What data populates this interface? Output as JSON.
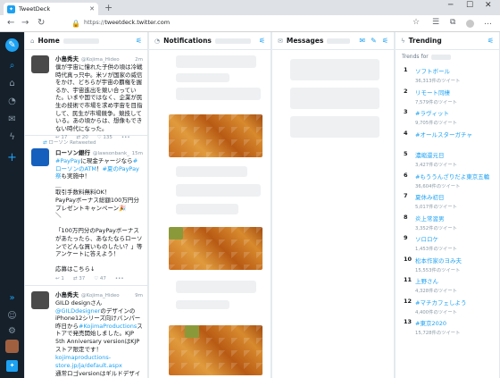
{
  "browser": {
    "tab_title": "TweetDeck",
    "tab_icon": "twitter-bird-icon",
    "url_prefix": "https://",
    "url_host": "tweetdeck.twitter.com"
  },
  "columns": {
    "home": {
      "title": "Home"
    },
    "notifications": {
      "title": "Notifications"
    },
    "messages": {
      "title": "Messages"
    },
    "trending": {
      "title": "Trending",
      "trends_for": "Trends for"
    }
  },
  "tweets": [
    {
      "name": "小島秀夫",
      "handle": "@Kojima_Hideo",
      "time": "2m",
      "body": "僕が宇宙に憧れた子供の頃は冷戦時代真っ只中。米ソが国家の威信をかけ、どちらが宇宙の覇権を握るか、宇宙進出を競い合っていた。いまや国ではなく、企業が民生の技術で市場を求め宇宙を目指して、民生が市場競争。競技している。あの頃からは、想像もできない時代になった。",
      "replies": "17",
      "retweets": "20",
      "likes": "135"
    },
    {
      "retweet_note": "ローソン Retweeted",
      "name": "ローソン銀行",
      "handle": "@lawsonbank_jp",
      "time": "15m",
      "body_line1_hashtag1": "#PayPay",
      "body_line1_mid": "に現金チャージなら",
      "body_line1_hashtag2": "#ローソンのATM",
      "body_line1_mark": "！",
      "body_line1_hashtag3": "#夏のPayPay祭",
      "body_line1_end": "も実施中！",
      "body_rest": "＿\n取引手数料無料OK！\nPayPayボーナス総額100万円分プレゼントキャンペーン🎉\n＼\n\n「100万円分のPayPayボーナスがあたったら、あなたならローソンでどんな買いものしたい？」等アンケートに答えよう！\n\n応募はこちら↓",
      "replies": "1",
      "retweets": "37",
      "likes": "47"
    },
    {
      "name": "小島秀夫",
      "handle": "@Kojima_Hideo",
      "time": "9m",
      "body_start": "GILD designさん",
      "body_mention": "@GILDdesigner",
      "body_mid": "のデザインのiPhone12シリーズ向けバンパー昨日から",
      "body_hashtag": "#KojimaProductions",
      "body_end": "ストアで発売開始しました。KJP 5th Anniversary versionはKJPストア限定です！",
      "link": "kojimaproductions-store.jp/ja/default.aspx",
      "body_tail": "通常ロゴversionはギルドデザイン直営取扱店(一部店舗除く)にて販売予定です。"
    }
  ],
  "trends": [
    {
      "rank": "1",
      "name": "ソフトボール",
      "count": "36,313件のツイート"
    },
    {
      "rank": "2",
      "name": "リモート同棲",
      "count": "7,579件のツイート"
    },
    {
      "rank": "3",
      "name": "#ラヴィット",
      "count": "9,705件のツイート"
    },
    {
      "rank": "4",
      "name": "#オールスターガチャ",
      "count": ""
    },
    {
      "rank": "5",
      "name": "濃縮還元日",
      "count": "3,427件のツイート"
    },
    {
      "rank": "6",
      "name": "#もううんざりだよ東京五輪",
      "count": "36,604件のツイート"
    },
    {
      "rank": "7",
      "name": "夏休み初日",
      "count": "5,017件のツイート"
    },
    {
      "rank": "8",
      "name": "炎上常習男",
      "count": "3,352件のツイート"
    },
    {
      "rank": "9",
      "name": "ソロロケ",
      "count": "1,453件のツイート"
    },
    {
      "rank": "10",
      "name": "松本作家のヨみ夫",
      "count": "15,553件のツイート"
    },
    {
      "rank": "11",
      "name": "上野さん",
      "count": "4,328件のツイート"
    },
    {
      "rank": "12",
      "name": "#マチカフェしよう",
      "count": "4,400件のツイート"
    },
    {
      "rank": "13",
      "name": "#東京2020",
      "count": "15,728件のツイート"
    }
  ],
  "colors": {
    "accent": "#1da1f2",
    "sidebar": "#15202b"
  }
}
